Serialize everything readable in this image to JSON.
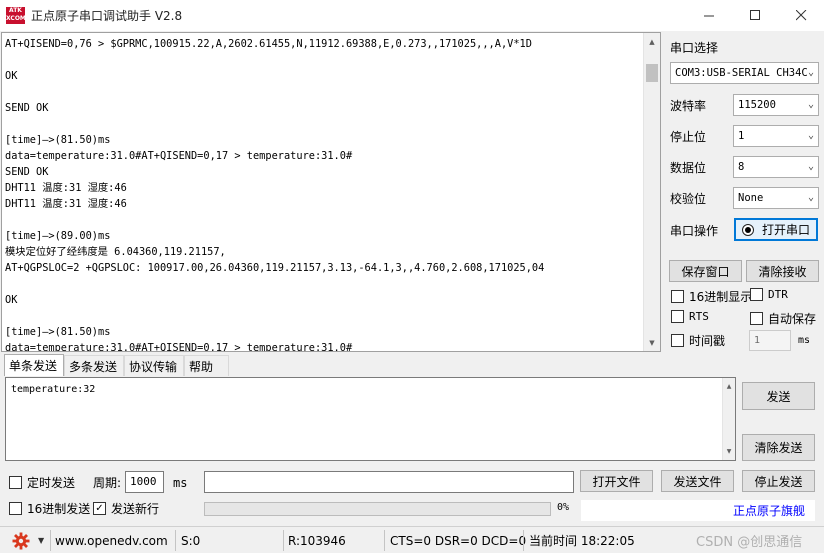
{
  "window": {
    "title": "正点原子串口调试助手 V2.8",
    "logo_text_top": "ATK",
    "logo_text_bottom": "XCOM"
  },
  "receive": {
    "lines": [
      "AT+QISEND=0,76 > $GPRMC,100915.22,A,2602.61455,N,11912.69388,E,0.273,,171025,,,A,V*1D",
      "",
      "OK",
      "",
      "SEND OK",
      "",
      "[time]—>(81.50)ms",
      "data=temperature:31.0#AT+QISEND=0,17 > temperature:31.0#",
      "SEND OK",
      "DHT11 温度:31 湿度:46",
      "DHT11 温度:31 湿度:46",
      "",
      "[time]—>(89.00)ms",
      "模块定位好了经纬度是 6.04360,119.21157,",
      "AT+QGPSLOC=2 +QGPSLOC: 100917.00,26.04360,119.21157,3.13,-64.1,3,,4.760,2.608,171025,04",
      "",
      "OK",
      "",
      "[time]—>(81.50)ms",
      "data=temperature:31.0#AT+QISEND=0,17 > temperature:31.0#"
    ]
  },
  "settings": {
    "port_label": "串口选择",
    "port_value": "COM3:USB-SERIAL CH34C",
    "baud_label": "波特率",
    "baud_value": "115200",
    "stop_label": "停止位",
    "stop_value": "1",
    "data_label": "数据位",
    "data_value": "8",
    "parity_label": "校验位",
    "parity_value": "None",
    "op_label": "串口操作",
    "open_port_button": "打开串口",
    "save_window_button": "保存窗口",
    "clear_recv_button": "清除接收",
    "hex_display": "16进制显示",
    "dtr": "DTR",
    "rts": "RTS",
    "auto_save": "自动保存",
    "timestamp": "时间戳",
    "timestamp_value": "1",
    "timestamp_unit": "ms"
  },
  "tabs": [
    "单条发送",
    "多条发送",
    "协议传输",
    "帮助"
  ],
  "send": {
    "text": "temperature:32",
    "send_button": "发送",
    "clear_send_button": "清除发送",
    "timed_send": "定时发送",
    "period_label": "周期:",
    "period_value": "1000",
    "period_unit": "ms",
    "open_file_button": "打开文件",
    "send_file_button": "发送文件",
    "stop_send_button": "停止发送",
    "hex_send": "16进制发送",
    "newline": "发送新行",
    "progress_text": "0%",
    "progress_value": 0,
    "flagship_link": "正点原子旗舰"
  },
  "status": {
    "website": "www.openedv.com",
    "s": "S:0",
    "r": "R:103946",
    "signals": "CTS=0 DSR=0 DCD=0",
    "time": "当前时间 18:22:05",
    "watermark": "CSDN @创思通信"
  }
}
